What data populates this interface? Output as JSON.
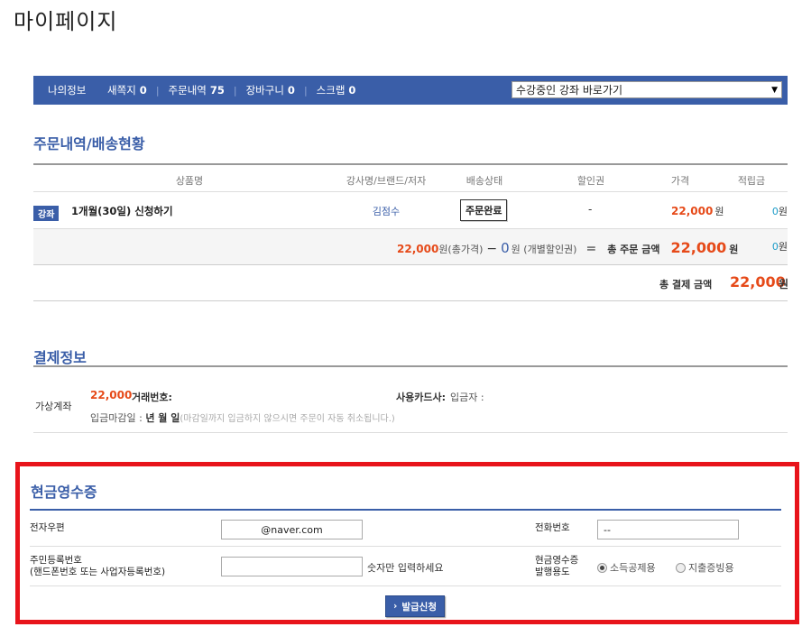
{
  "page": {
    "title": "마이페이지"
  },
  "nav": {
    "items": [
      {
        "label": "나의정보",
        "count": ""
      },
      {
        "label": "새쪽지",
        "count": "0"
      },
      {
        "label": "주문내역",
        "count": "75"
      },
      {
        "label": "장바구니",
        "count": "0"
      },
      {
        "label": "스크랩",
        "count": "0"
      }
    ],
    "course_select": "수강중인 강좌 바로가기"
  },
  "orders": {
    "title": "주문내역/배송현황",
    "headers": [
      "상품명",
      "강사명/브랜드/저자",
      "배송상태",
      "할인권",
      "가격",
      "적립금"
    ],
    "row": {
      "tag": "강좌",
      "product": "1개월(30일) 신청하기",
      "instructor": "김점수",
      "status": "주문완료",
      "coupon": "-",
      "price": "22,000",
      "price_unit": "원",
      "points": "0",
      "points_unit": "원"
    },
    "summary": {
      "total_price": "22,000",
      "total_price_label": "원(총가격)",
      "minus": "−",
      "discount": "0",
      "discount_label": "원 (개별할인권)",
      "equals": "=",
      "order_total_label": "총 주문 금액",
      "order_total": "22,000",
      "won": "원",
      "points": "0",
      "points_unit": "원"
    },
    "payment_total": {
      "label": "총 결제 금액",
      "amount": "22,000",
      "unit": "원"
    }
  },
  "payment": {
    "title": "결제정보",
    "method": "가상계좌",
    "amount": "22,000",
    "txn_label": "거래번호:",
    "card_label": "사용카드사:",
    "depositor_label": "입금자 :",
    "deadline_label": "입금마감일 :",
    "deadline_value": "년 월 일",
    "deadline_note": "(마감일까지 입금하지 않으시면 주문이 자동 취소됩니다.)"
  },
  "receipt": {
    "title": "현금영수증",
    "email_label": "전자우편",
    "email_value": "@naver.com",
    "phone_label": "전화번호",
    "phone_value": "--",
    "id_label_1": "주민등록번호",
    "id_label_2": "(핸드폰번호 또는 사업자등록번호)",
    "id_value": "",
    "id_hint": "숫자만 입력하세요",
    "usage_label_1": "현금영수증",
    "usage_label_2": "발행용도",
    "usage_options": [
      "소득공제용",
      "지출증빙용"
    ],
    "usage_selected": "소득공제용",
    "issue_button": "발급신청"
  },
  "colors": {
    "brand": "#3a5ea8",
    "accent": "#e64a19",
    "highlight_border": "#e8141b",
    "points": "#1a9bc8"
  }
}
